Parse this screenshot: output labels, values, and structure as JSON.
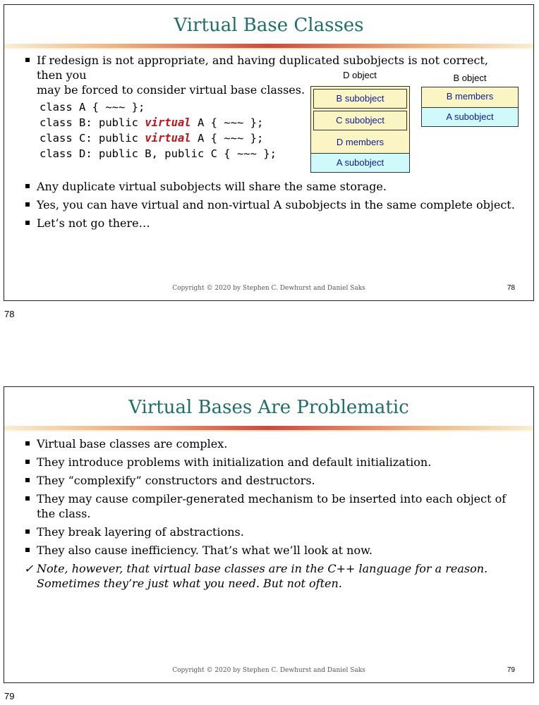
{
  "slide1": {
    "title": "Virtual Base Classes",
    "bullet1_line1": "If redesign is not appropriate, and having duplicated subobjects is not correct, then you",
    "bullet1_line2": "may be forced to consider virtual base classes.",
    "code": [
      {
        "pre": "class A { ~~~ };",
        "kw": "",
        "post": ""
      },
      {
        "pre": "class B: public ",
        "kw": "virtual",
        "post": " A { ~~~ };"
      },
      {
        "pre": "class C: public ",
        "kw": "virtual",
        "post": " A { ~~~ };"
      },
      {
        "pre": "class D: public B, public C { ~~~ };",
        "kw": "",
        "post": ""
      }
    ],
    "bullets": [
      "Any duplicate virtual subobjects will share the same storage.",
      "Yes, you can have virtual and non-virtual A subobjects in the same complete object.",
      "Let’s not go there…"
    ],
    "d_object": {
      "label": "D object",
      "parts": [
        "B subobject",
        "C subobject",
        "D members",
        "A subobject"
      ]
    },
    "b_object": {
      "label": "B object",
      "parts": [
        "B members",
        "A subobject"
      ]
    },
    "copyright": "Copyright © 2020 by Stephen C. Dewhurst and Daniel Saks",
    "page": "78",
    "outer_page": "78"
  },
  "slide2": {
    "title": "Virtual Bases Are Problematic",
    "bullets": [
      "Virtual base classes are complex.",
      "They introduce problems with initialization and default initialization.",
      "They “complexify” constructors and destructors.",
      "They may cause compiler-generated mechanism to be inserted into each object of the class.",
      "They break layering of abstractions.",
      "They also cause inefficiency.  That’s what we’ll look at now."
    ],
    "check_mark": "✓",
    "check_note": "Note, however, that virtual base classes are in the C++ language for a reason.  Sometimes they’re just what you need.  But not often.",
    "copyright": "Copyright © 2020 by Stephen C. Dewhurst and Daniel Saks",
    "page": "79",
    "outer_page": "79"
  },
  "colors": {
    "title": "#1f6f6a",
    "keyword": "#c0141c",
    "box_text": "#0d1a9c",
    "yellow_box": "#fbf5c4",
    "cyan_box": "#cff9fb"
  }
}
